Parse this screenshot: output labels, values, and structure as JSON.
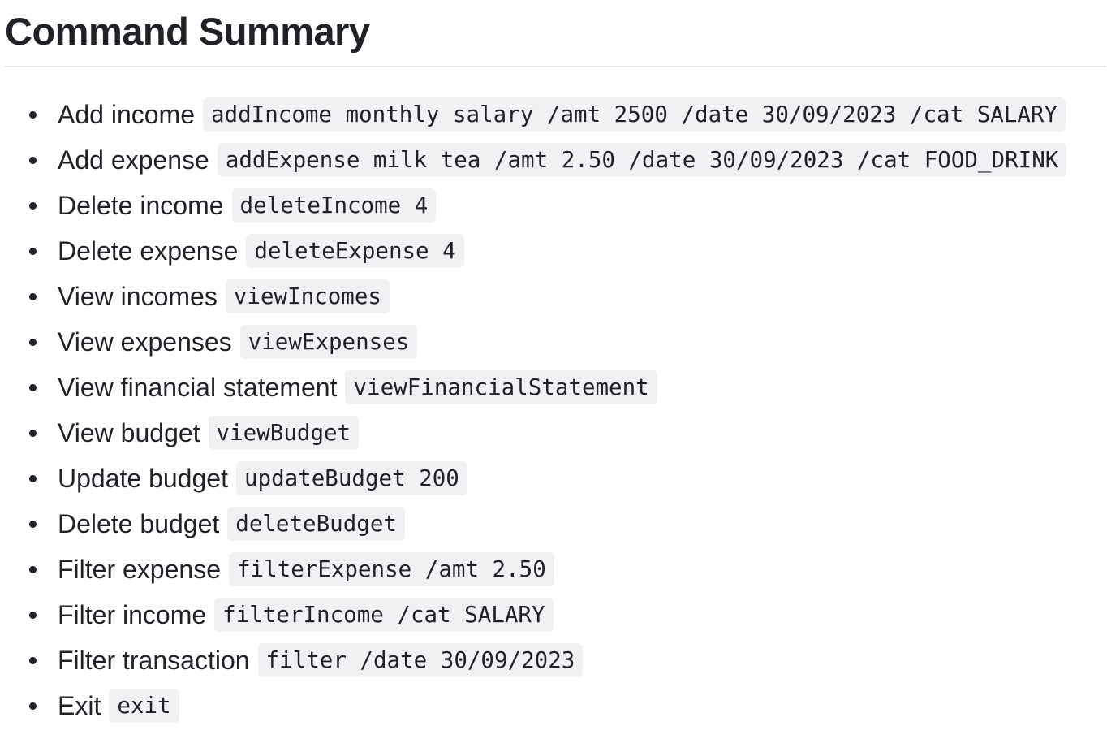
{
  "page": {
    "title": "Command Summary"
  },
  "commands": [
    {
      "label": "Add income",
      "code": "addIncome monthly salary /amt 2500 /date 30/09/2023 /cat SALARY"
    },
    {
      "label": "Add expense",
      "code": "addExpense milk tea /amt 2.50 /date 30/09/2023 /cat FOOD_DRINK"
    },
    {
      "label": "Delete income",
      "code": "deleteIncome 4"
    },
    {
      "label": "Delete expense",
      "code": "deleteExpense 4"
    },
    {
      "label": "View incomes",
      "code": "viewIncomes"
    },
    {
      "label": "View expenses",
      "code": "viewExpenses"
    },
    {
      "label": "View financial statement",
      "code": "viewFinancialStatement"
    },
    {
      "label": "View budget",
      "code": "viewBudget"
    },
    {
      "label": "Update budget",
      "code": "updateBudget 200"
    },
    {
      "label": "Delete budget",
      "code": "deleteBudget"
    },
    {
      "label": "Filter expense",
      "code": "filterExpense /amt 2.50"
    },
    {
      "label": "Filter income",
      "code": "filterIncome /cat SALARY"
    },
    {
      "label": "Filter transaction",
      "code": "filter /date 30/09/2023"
    },
    {
      "label": "Exit",
      "code": "exit"
    }
  ]
}
